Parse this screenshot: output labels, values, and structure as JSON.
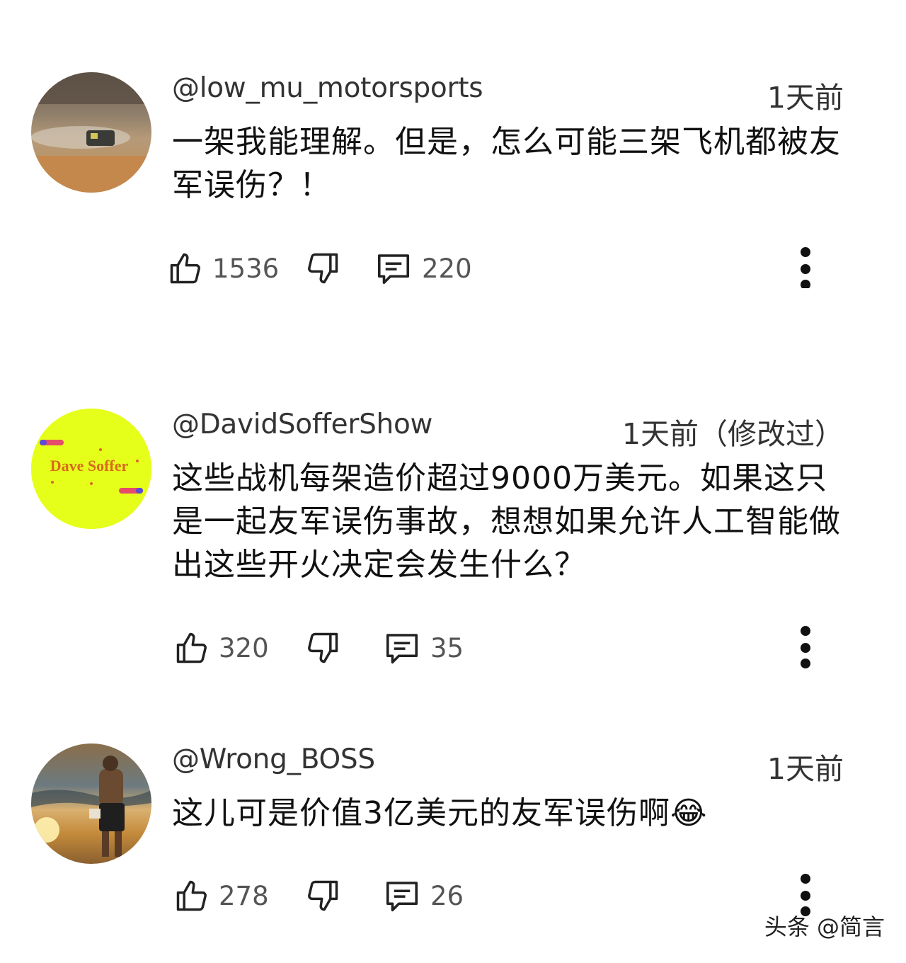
{
  "comments": [
    {
      "author": "@low_mu_motorsports",
      "time": "1天前",
      "text": "一架我能理解。但是，怎么可能三架飞机都被友军误伤？！",
      "likes": "1536",
      "replies": "220"
    },
    {
      "author": "@DavidSofferShow",
      "time": "1天前（修改过）",
      "text": "这些战机每架造价超过9000万美元。如果这只是一起友军误伤事故，想想如果允许人工智能做出这些开火决定会发生什么？",
      "likes": "320",
      "replies": "35",
      "avatar_logo_text": "Dave Soffer"
    },
    {
      "author": "@Wrong_BOSS",
      "time": "1天前",
      "text": "这儿可是价值3亿美元的友军误伤啊😂",
      "likes": "278",
      "replies": "26"
    }
  ],
  "icons": {
    "like": "thumbs-up-icon",
    "dislike": "thumbs-down-icon",
    "reply": "comment-icon",
    "more": "more-vertical-icon"
  },
  "watermark": "头条 @简言",
  "colors": {
    "text": "#0f0f0f",
    "secondary": "#555555",
    "avatar2_bg": "#e6ff1a"
  }
}
